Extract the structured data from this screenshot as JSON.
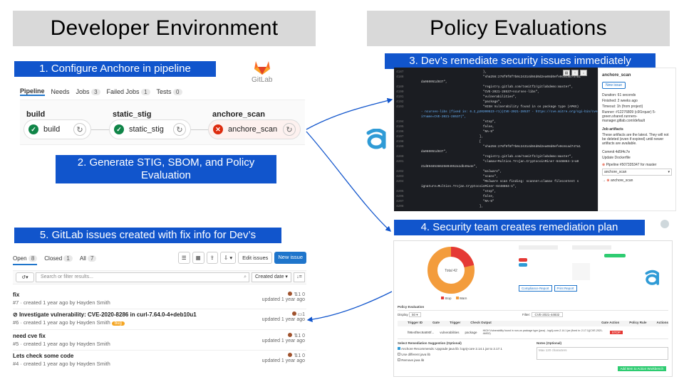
{
  "headers": {
    "left": "Developer Environment",
    "right": "Policy Evaluations"
  },
  "steps": {
    "s1": "1. Configure Anchore in pipeline",
    "s2a": "2. Generate STIG, SBOM, and Policy",
    "s2b": "Evaluation",
    "s3": "3. Dev’s remediate security issues immediately",
    "s4": "4. Security team creates remediation plan",
    "s5": "5. GitLab issues created with fix info for Dev’s"
  },
  "gitlab_logo_text": "GitLab",
  "pipeline": {
    "tabs": [
      {
        "label": "Pipeline",
        "count": ""
      },
      {
        "label": "Needs",
        "count": ""
      },
      {
        "label": "Jobs",
        "count": "3"
      },
      {
        "label": "Failed Jobs",
        "count": "1"
      },
      {
        "label": "Tests",
        "count": "0"
      }
    ],
    "stages": [
      {
        "name": "build",
        "job": "build",
        "status": "passed"
      },
      {
        "name": "static_stig",
        "job": "static_stig",
        "status": "passed"
      },
      {
        "name": "anchore_scan",
        "job": "anchore_scan",
        "status": "failed"
      }
    ]
  },
  "job_log": {
    "lines": [
      {
        "n": "4187",
        "t": "                                    },"
      },
      {
        "n": "4188",
        "t": "                                    \"sha256:278f9f8f7b0c24314d04d0d2ea08d0efe0c8cad747a1"
      },
      {
        "n": "",
        "t": "   da060051d937\","
      },
      {
        "n": "4189",
        "t": "                                    \"registry.gitlab.com/tomitf2/gitlabdemo:master\","
      },
      {
        "n": "4190",
        "t": "                                    \"CVE-2021-28537+ncurses-libs\","
      },
      {
        "n": "4191",
        "t": "                                    \"vulnerabilities\","
      },
      {
        "n": "4192",
        "t": "                                    \"package\","
      },
      {
        "n": "4193",
        "t": "                                    \"HIGH Vulnerability found in os package type (APKG)"
      },
      {
        "n": "",
        "t": "   - ncurses-libs (fixed in: 6.2_p20200523-r1)(CVE-2021-28537 - https://cve.mitre.org/cgi-bin/cvename.cg"
      },
      {
        "n": "",
        "t": "   i?name=CVE-2021-28537)\","
      },
      {
        "n": "4194",
        "t": "                                    \"stop\","
      },
      {
        "n": "4195",
        "t": "                                    false,"
      },
      {
        "n": "4196",
        "t": "                                    \"RA-5\""
      },
      {
        "n": "4197",
        "t": "                                  ],"
      },
      {
        "n": "4198",
        "t": "                                  ["
      },
      {
        "n": "4199",
        "t": "                                    \"sha256:278f9f8f7b0c24314d04d0d2ea08d0efe0c8cad747a1"
      },
      {
        "n": "",
        "t": "   da060051d937\","
      },
      {
        "n": "4200",
        "t": "                                    \"registry.gitlab.com/tomitf2/gitlabdemo:master\","
      },
      {
        "n": "4201",
        "t": "                                    \"clamav+Multios.Trojan.CryptocoinMiner-6448864-1+a0"
      },
      {
        "n": "",
        "t": "   21d8948538625894952a1db49a4e\","
      },
      {
        "n": "4202",
        "t": "                                    \"malware\","
      },
      {
        "n": "4203",
        "t": "                                    \"scans\","
      },
      {
        "n": "4204",
        "t": "                                    \"Malware scan finding: scanner=clamav filecontent s"
      },
      {
        "n": "",
        "t": "   ignature=Multios.Trojan.CryptocoinMiner-6448864-1\","
      },
      {
        "n": "4205",
        "t": "                                    \"stop\","
      },
      {
        "n": "4206",
        "t": "                                    false,"
      },
      {
        "n": "4207",
        "t": "                                    \"RA-5\""
      },
      {
        "n": "4208",
        "t": "                                  ],"
      }
    ],
    "sidebar": {
      "title": "anchore_scan",
      "button": "New issue",
      "duration": "Duration: 61 seconds",
      "finished": "Finished: 2 weeks ago",
      "timeout": "Timeout: 1h (from project)",
      "runner": "Runner: #12276809 (c9l1rqusr) 5-green.shared.runners-manager.gitlab.com/default",
      "artifacts_title": "Job artifacts",
      "artifacts_text": "These artifacts are the latest. They will not be deleted (even if expired) until newer artifacts are available.",
      "commit": "Commit 4d5f4c7e",
      "commit_msg": "Update Dockerfile",
      "pipeline": "Pipeline #507335347 for master",
      "select": "anchore_scan",
      "job_link": "anchore_scan"
    }
  },
  "issues": {
    "tabs": [
      {
        "label": "Open",
        "count": "8"
      },
      {
        "label": "Closed",
        "count": "1"
      },
      {
        "label": "All",
        "count": "7"
      }
    ],
    "edit_button": "Edit issues",
    "new_button": "New issue",
    "search_placeholder": "Search or filter results...",
    "sort": "Created date",
    "list": [
      {
        "title": "fix",
        "meta": "#7 · created 1 year ago by Hayden Smith",
        "counts": "1   0",
        "updated": "updated 1 year ago",
        "label": ""
      },
      {
        "title": "Investigate vulnerability: CVE-2020-8286 in curl-7.64.0-4+deb10u1",
        "meta": "#6 · created 1 year ago by Hayden Smith",
        "counts": "1",
        "updated": "updated 1 year ago",
        "label": "bug"
      },
      {
        "title": "need cve fix",
        "meta": "#5 · created 1 year ago by Hayden Smith",
        "counts": "1   0",
        "updated": "updated 1 year ago",
        "label": ""
      },
      {
        "title": "Lets check some code",
        "meta": "#4 · created 1 year ago by Hayden Smith",
        "counts": "1   0",
        "updated": "updated 1 year ago",
        "label": ""
      }
    ]
  },
  "security": {
    "donut_label": "Total 42",
    "donut_values": {
      "stop": 9,
      "warn": 33
    },
    "legend": [
      "Stop",
      "Warn"
    ],
    "policy_title": "Policy Evaluation",
    "display": "Display",
    "entries": "50",
    "filter_label": "Filter:",
    "filter_value": "CVE-2021-44832",
    "columns": [
      "Trigger ID",
      "Gate",
      "Trigger",
      "Check Output",
      "Gate Action",
      "Policy Rule",
      "Actions"
    ],
    "row": {
      "id": "f98e4f8ec9a890f...",
      "gate": "vulnerabilities",
      "trigger": "package",
      "output": "HIGH Vulnerability found in non-os package type (java) - log4j-core-2.14.1.jar (fixed in: 2.17.1)(CVE-2021-44832)",
      "action": "STOP"
    },
    "remediation_title": "Select Remediation Suggestion (Optional)",
    "opt1": "Anchore Recommends: Upgrade java lib: log4j-core 2.14.1 jar to 2.17.1",
    "opt2": "Use different java lib",
    "opt3": "Remove java lib",
    "notes_title": "Notes (Optional)",
    "notes_placeholder": "Max 120 characters",
    "add_button": "Add Item to Action Workbench",
    "compliance_btn": "Compliance Report",
    "print_btn": "Print Report"
  },
  "colors": {
    "accent": "#1155cc",
    "header_bg": "#d9d9d9",
    "anchore_blue": "#2f9bd6",
    "gitlab_orange": "#fc6d26",
    "fail_red": "#dd2b0e",
    "pass_green": "#108548"
  }
}
